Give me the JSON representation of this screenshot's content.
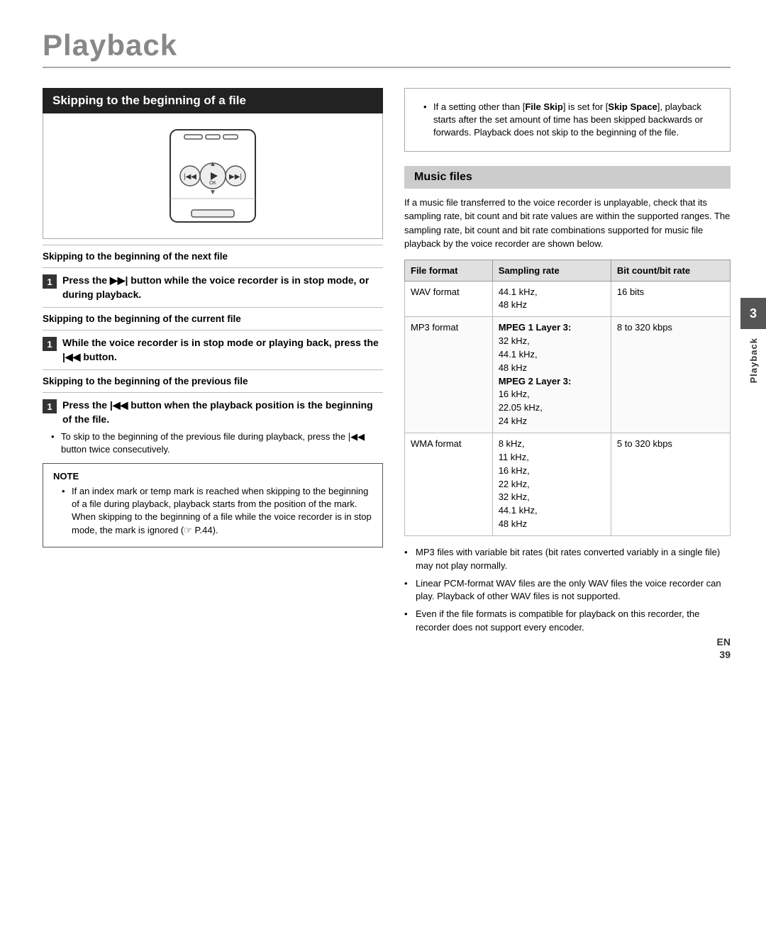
{
  "page": {
    "title": "Playback",
    "page_number": "39",
    "lang_label": "EN"
  },
  "left_col": {
    "section_heading": "Skipping to the beginning of a file",
    "sub1_label": "Skipping to the beginning of the next file",
    "step1_text_html": "Press the ▶▶| button while the voice recorder is in stop mode, or during playback.",
    "sub2_label": "Skipping to the beginning of the current file",
    "step2_text_html": "While the voice recorder is in stop mode or playing back, press the |◀◀ button.",
    "sub3_label": "Skipping to the beginning of the previous file",
    "step3_text_html": "Press the |◀◀ button when the playback position is the beginning of the file.",
    "step3_bullet": "To skip to the beginning of the previous file during playback, press the |◀◀ button twice consecutively.",
    "note_label": "NOTE",
    "note_text": "If an index mark or temp mark is reached when skipping to the beginning of a file during playback, playback starts from the position of the mark. When skipping to the beginning of a file while the voice recorder is in stop mode, the mark is ignored (☞ P.44)."
  },
  "right_col": {
    "right_note_text": "• If a setting other than [File Skip] is set for [Skip Space], playback starts after the set amount of time has been skipped backwards or forwards. Playback does not skip to the beginning of the file.",
    "music_files_heading": "Music files",
    "music_intro": "If a music file transferred to the voice recorder is unplayable, check that its sampling rate, bit count and bit rate values are within the supported ranges. The sampling rate, bit count and bit rate combinations supported for music file playback by the voice recorder are shown below.",
    "table": {
      "headers": [
        "File format",
        "Sampling rate",
        "Bit count/bit rate"
      ],
      "rows": [
        {
          "format": "WAV format",
          "sampling": "44.1 kHz,\n48 kHz",
          "bitrate": "16 bits"
        },
        {
          "format": "MP3 format",
          "sampling": "MPEG 1 Layer 3:\n32 kHz,\n44.1 kHz,\n48 kHz\nMPEG 2 Layer 3:\n16 kHz,\n22.05 kHz,\n24 kHz",
          "bitrate": "8 to 320 kbps"
        },
        {
          "format": "WMA format",
          "sampling": "8 kHz,\n11 kHz,\n16 kHz,\n22 kHz,\n32 kHz,\n44.1 kHz,\n48 kHz",
          "bitrate": "5 to 320 kbps"
        }
      ]
    },
    "bottom_bullets": [
      "MP3 files with variable bit rates (bit rates converted variably in a single file) may not play normally.",
      "Linear PCM-format WAV files are the only WAV files the voice recorder can play. Playback of other WAV files is not supported.",
      "Even if the file formats is compatible for playback on this recorder, the recorder does not support every encoder."
    ]
  },
  "right_tab": {
    "number": "3",
    "label": "Playback"
  }
}
